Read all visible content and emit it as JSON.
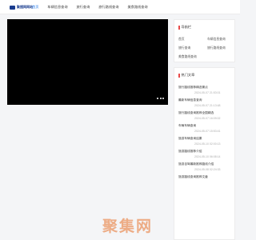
{
  "header": {
    "logo_text": "聚搜网网站",
    "nav": [
      "首页",
      "车辆信息查询",
      "旅行查询",
      "旅行路线查询",
      "美食路线查询"
    ],
    "active_index": 0
  },
  "player": {
    "more_icon": "more-dots-icon"
  },
  "categories": {
    "title": "导航栏",
    "items": [
      "首页",
      "车辆信息查询",
      "旅行查询",
      "旅行路线查询",
      "美食路线查询"
    ]
  },
  "hot": {
    "title": "热门文章",
    "items": [
      {
        "title": "旅行路线推荐精选景点",
        "date": "2024-05-07 21:53:01"
      },
      {
        "title": "最新车辆信息查询",
        "date": "2024-05-07 21:13:48"
      },
      {
        "title": "旅行路线查询推荐全国精选",
        "date": "2024-05-07 16:09:02"
      },
      {
        "title": "车辆车辆查询",
        "date": "2024-05-07 15:53:41"
      },
      {
        "title": "旅游车辆查询结果",
        "date": "2024-05-10 02:00:13"
      },
      {
        "title": "旅游路线推荐介绍",
        "date": "2024-05-10 06:08:14"
      },
      {
        "title": "旅游自驾最新推荐路线介绍",
        "date": "2024-05-08 02:24:33"
      },
      {
        "title": "旅游路线查询推荐文章",
        "date": ""
      }
    ]
  },
  "watermark": "聚集网",
  "colors": {
    "accent": "#1a73e8",
    "brand": "#1a3d8f",
    "marker": "#e84a4a"
  }
}
